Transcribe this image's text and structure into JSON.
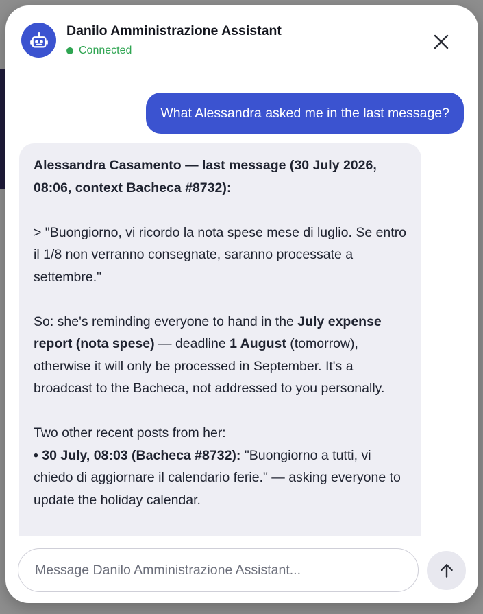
{
  "header": {
    "title": "Danilo Amministrazione Assistant",
    "status": "Connected",
    "avatar_icon": "robot-icon",
    "close_icon": "close-icon"
  },
  "colors": {
    "accent": "#3b53d0",
    "status_connected": "#2fa552",
    "assistant_bubble": "#eeeef4"
  },
  "messages": {
    "user_1": "What Alessandra asked me in the last message?",
    "assistant_1": {
      "heading": "Alessandra Casamento — last message (30 July 2026, 08:06, context Bacheca #8732):",
      "quote": "> \"Buongiorno, vi ricordo la nota spese mese di luglio. Se entro il 1/8 non verranno consegnate, saranno processate a settembre.\"",
      "p2_a": "So: she's reminding everyone to hand in the ",
      "p2_b": "July expense report (nota spese)",
      "p2_c": " — deadline ",
      "p2_d": "1 August",
      "p2_e": " (tomorrow), otherwise it will only be processed in September. It's a broadcast to the Bacheca, not addressed to you personally.",
      "p3_intro": "Two other recent posts from her:",
      "bullet_1_prefix": "• ",
      "bullet_1_bold": "30 July, 08:03 (Bacheca #8732):",
      "bullet_1_text": " \"Buongiorno a tutti, vi chiedo di aggiornare il calendario ferie.\" — asking everyone to update the holiday calendar."
    }
  },
  "composer": {
    "placeholder": "Message Danilo Amministrazione Assistant...",
    "send_icon": "arrow-up-icon"
  }
}
